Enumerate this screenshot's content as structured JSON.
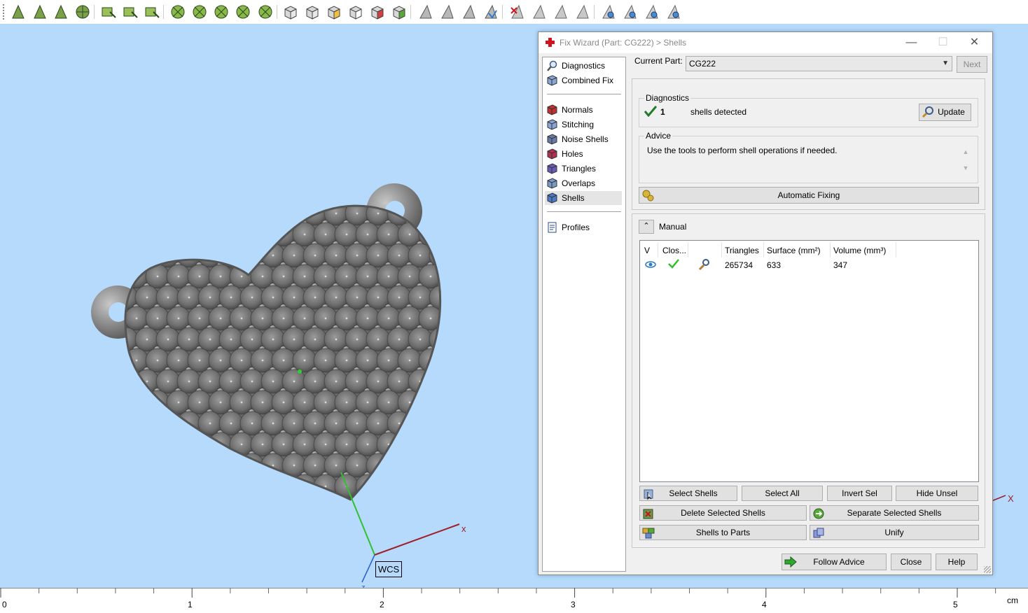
{
  "toolbar": {
    "icons": [
      "select-triangle-icon",
      "select-surface-icon",
      "select-curve-icon",
      "select-shell-icon",
      "rectangle-select-icon",
      "brush-select-icon",
      "lasso-select-icon",
      "mark-plane-icon",
      "mark-sphere-icon",
      "mark-cylinder-icon",
      "mark-cone-icon",
      "mark-torus-icon",
      "view-front-icon",
      "view-back-icon",
      "view-top-icon",
      "view-bottom-icon",
      "view-left-icon",
      "view-right-icon",
      "shaded-view-icon",
      "wireframe-view-icon",
      "triangles-view-icon",
      "normals-view-icon",
      "delete-triangles-icon",
      "invert-triangles-icon",
      "shaded-edges-icon",
      "transparent-icon",
      "measure-icon",
      "section-icon",
      "cut-icon",
      "hollow-icon"
    ]
  },
  "viewport": {
    "axes": {
      "x": "x",
      "z": "z",
      "wcs": "WCS",
      "corner_x": "X"
    },
    "ruler": {
      "ticks": [
        "0",
        "1",
        "2",
        "3",
        "4",
        "5"
      ],
      "unit": "cm"
    },
    "colors": {
      "background": "#b5dafc",
      "x_axis": "#a0202a",
      "y_axis": "#2fc22f",
      "model": "#7a7a7a"
    }
  },
  "dialog": {
    "title": "Fix Wizard (Part: CG222) > Shells",
    "window_buttons": {
      "minimize": "—",
      "maximize": "☐",
      "close": "✕"
    },
    "nav": {
      "top": [
        {
          "label": "Diagnostics",
          "icon": "magnifier-icon"
        },
        {
          "label": "Combined Fix",
          "icon": "combined-fix-icon"
        }
      ],
      "fixes": [
        {
          "label": "Normals",
          "icon": "normals-cube-icon"
        },
        {
          "label": "Stitching",
          "icon": "stitching-cube-icon"
        },
        {
          "label": "Noise Shells",
          "icon": "noise-shells-cube-icon"
        },
        {
          "label": "Holes",
          "icon": "holes-cube-icon"
        },
        {
          "label": "Triangles",
          "icon": "triangles-cube-icon"
        },
        {
          "label": "Overlaps",
          "icon": "overlaps-cube-icon"
        },
        {
          "label": "Shells",
          "icon": "shells-cube-icon"
        }
      ],
      "bottom": [
        {
          "label": "Profiles",
          "icon": "profiles-document-icon"
        }
      ]
    },
    "current_part": {
      "label": "Current Part:",
      "value": "CG222",
      "next": "Next"
    },
    "diagnostics": {
      "legend": "Diagnostics",
      "count": "1",
      "text": "shells detected",
      "update": "Update"
    },
    "advice": {
      "legend": "Advice",
      "text": "Use the tools to perform shell operations if needed."
    },
    "automatic_fixing": "Automatic Fixing",
    "manual": {
      "title": "Manual",
      "columns": [
        "V",
        "Clos...",
        "",
        "Triangles",
        "Surface (mm²)",
        "Volume (mm³)"
      ],
      "rows": [
        {
          "triangles": "265734",
          "surface": "633",
          "volume": "347"
        }
      ],
      "buttons": {
        "select_shells": "Select Shells",
        "select_all": "Select All",
        "invert_sel": "Invert Sel",
        "hide_unsel": "Hide Unsel",
        "delete_selected": "Delete Selected Shells",
        "separate_selected": "Separate Selected Shells",
        "shells_to_parts": "Shells to Parts",
        "unify": "Unify"
      }
    },
    "footer": {
      "follow_advice": "Follow Advice",
      "close": "Close",
      "help": "Help"
    }
  }
}
